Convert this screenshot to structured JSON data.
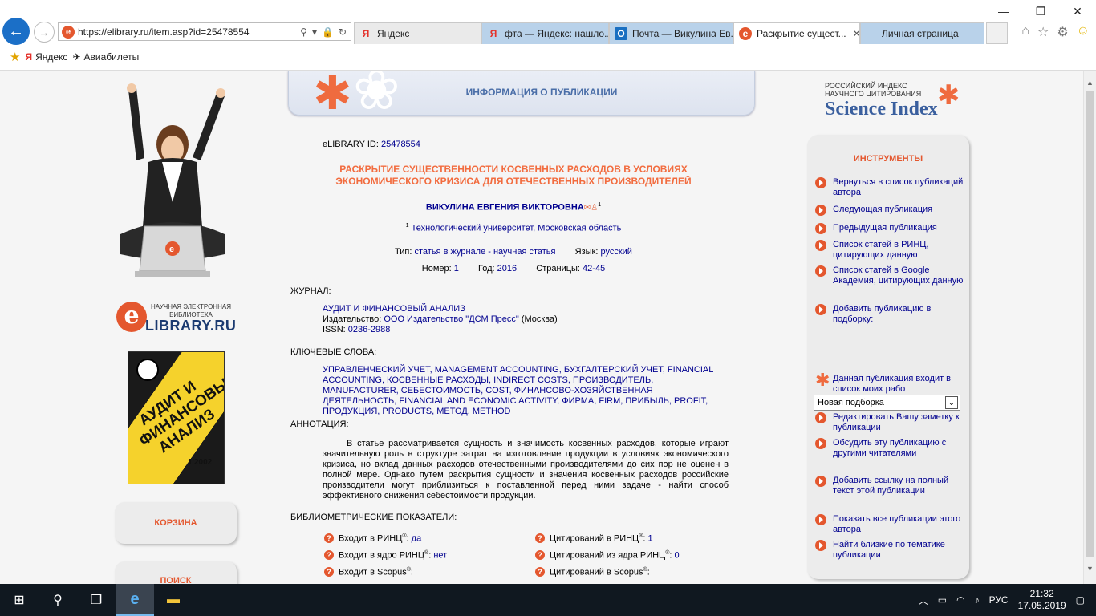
{
  "browser": {
    "url": "https://elibrary.ru/item.asp?id=25478554",
    "tabs": [
      {
        "label": "Яндекс",
        "icon": "Я",
        "icon_color": "#e4322b"
      },
      {
        "label": "фта — Яндекс: нашло...",
        "icon": "Я",
        "icon_color": "#e4322b"
      },
      {
        "label": "Почта — Викулина Ев...",
        "icon": "O",
        "icon_color": "#1a6fc1"
      },
      {
        "label": "Раскрытие сущест...",
        "icon": "e",
        "icon_color": "#e4572e"
      },
      {
        "label": "Личная страница",
        "icon": "",
        "icon_color": ""
      }
    ],
    "favorites": [
      {
        "label": "Яндекс",
        "icon": "yandex-icon"
      },
      {
        "label": "Авиабилеты",
        "icon": "plane-icon"
      }
    ]
  },
  "left": {
    "logo_small": "НАУЧНАЯ ЭЛЕКТРОННАЯ БИБЛИОТЕКА",
    "logo_e": "e",
    "logo_big": "LIBRARY.RU",
    "cover_title": "АУДИТ И ФИНАНСОВЫЙ АНАЛИЗ",
    "cover_year": "1'2002",
    "cart_label": "КОРЗИНА",
    "search_label": "ПОИСК"
  },
  "header": {
    "title": "ИНФОРМАЦИЯ О ПУБЛИКАЦИИ"
  },
  "publication": {
    "id_label": "eLIBRARY ID:",
    "id": "25478554",
    "title": "РАСКРЫТИЕ СУЩЕСТВЕННОСТИ КОСВЕННЫХ РАСХОДОВ В УСЛОВИЯХ ЭКОНОМИЧЕСКОГО КРИЗИСА ДЛЯ ОТЕЧЕСТВЕННЫХ ПРОИЗВОДИТЕЛЕЙ",
    "author": "ВИКУЛИНА ЕВГЕНИЯ ВИКТОРОВНА",
    "author_sup": "1",
    "affil_sup": "1",
    "affiliation": "Технологический университет, Московская область",
    "type_label": "Тип:",
    "type": "статья в журнале - научная статья",
    "lang_label": "Язык:",
    "lang": "русский",
    "number_label": "Номер:",
    "number": "1",
    "year_label": "Год:",
    "year": "2016",
    "pages_label": "Страницы:",
    "pages": "42-45",
    "journal_head": "ЖУРНАЛ:",
    "journal": "АУДИТ И ФИНАНСОВЫЙ АНАЛИЗ",
    "publisher_label": "Издательство:",
    "publisher": "ООО Издательство \"ДСМ Пресс\"",
    "publisher_city": "(Москва)",
    "issn_label": "ISSN:",
    "issn": "0236-2988",
    "keywords_head": "КЛЮЧЕВЫЕ СЛОВА:",
    "keywords": "УПРАВЛЕНЧЕСКИЙ УЧЕТ, MANAGEMENT ACCOUNTING, БУХГАЛТЕРСКИЙ УЧЕТ, FINANCIAL ACCOUNTING, КОСВЕННЫЕ РАСХОДЫ, INDIRECT COSTS, ПРОИЗВОДИТЕЛЬ, MANUFACTURER, СЕБЕСТОИМОСТЬ, COST, ФИНАНСОВО-ХОЗЯЙСТВЕННАЯ ДЕЯТЕЛЬНОСТЬ, FINANCIAL AND ECONOMIC ACTIVITY, ФИРМА, FIRM, ПРИБЫЛЬ, PROFIT, ПРОДУКЦИЯ, PRODUCTS, МЕТОД, METHOD",
    "abstract_head": "АННОТАЦИЯ:",
    "abstract": "В статье рассматривается сущность и значимость косвенных расходов, которые играют значительную роль в структуре затрат на изготовление продукции в условиях экономического кризиса, но вклад данных расходов отечественными производителями до сих пор не оценен в полной мере. Однако путем раскрытия сущности и значения косвенных расходов российские производители могут приблизиться к поставленной перед ними задаче - найти способ эффективного снижения себестоимости продукции.",
    "biblio_head": "БИБЛИОМЕТРИЧЕСКИЕ ПОКАЗАТЕЛИ:",
    "indicators_left": [
      {
        "label": "Входит в РИНЦ",
        "value": "да"
      },
      {
        "label": "Входит в ядро РИНЦ",
        "value": "нет"
      },
      {
        "label": "Входит в Scopus",
        "value": ""
      }
    ],
    "indicators_right": [
      {
        "label": "Цитирований в РИНЦ",
        "value": "1"
      },
      {
        "label": "Цитирований из ядра РИНЦ",
        "value": "0"
      },
      {
        "label": "Цитирований в Scopus",
        "value": ""
      }
    ],
    "reg_mark": "®"
  },
  "right": {
    "logo_l1": "РОССИЙСКИЙ ИНДЕКС",
    "logo_l2": "НАУЧНОГО ЦИТИРОВАНИЯ",
    "logo_big": "Science Index",
    "tools_head": "ИНСТРУМЕНТЫ",
    "tools": [
      "Вернуться в список публикаций автора",
      "Следующая публикация",
      "Предыдущая публикация",
      "Список статей в РИНЦ, цитирующих данную",
      "Список статей в Google Академия, цитирующих данную",
      "Добавить публикацию в подборку:",
      "Данная публикация входит в список моих работ",
      "Редактировать Вашу заметку к публикации",
      "Обсудить эту публикацию с другими читателями",
      "Добавить ссылку на полный текст этой публикации",
      "Показать все публикации этого автора",
      "Найти близкие по тематике публикации"
    ],
    "select_value": "Новая подборка"
  },
  "taskbar": {
    "lang": "РУС",
    "time": "21:32",
    "date": "17.05.2019"
  }
}
